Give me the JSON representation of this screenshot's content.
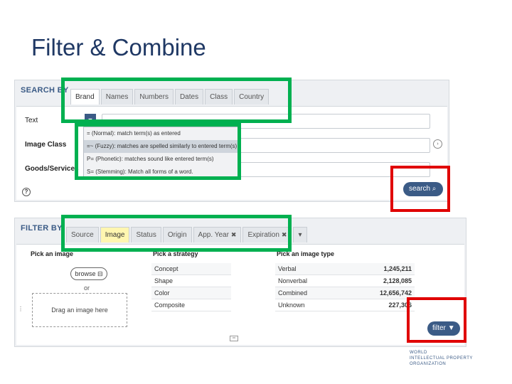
{
  "slide": {
    "title": "Filter & Combine"
  },
  "search": {
    "heading": "SEARCH BY",
    "tabs": [
      "Brand",
      "Names",
      "Numbers",
      "Dates",
      "Class",
      "Country"
    ],
    "active_tab": "Brand",
    "rows": {
      "text": "Text",
      "image_class": "Image Class",
      "goods_services": "Goods/Services"
    },
    "mode_menu": [
      "=  (Normal): match term(s) as entered",
      "=~ (Fuzzy): matches are spelled similarly to entered term(s)",
      "P= (Phonetic): matches sound like entered term(s)",
      "S= (Stemming): Match all forms of a word."
    ],
    "selected_mode_index": 1,
    "search_button": "search",
    "help_icon": "?"
  },
  "filter": {
    "heading": "FILTER BY",
    "tabs": [
      {
        "label": "Source",
        "closable": false
      },
      {
        "label": "Image",
        "closable": false
      },
      {
        "label": "Status",
        "closable": false
      },
      {
        "label": "Origin",
        "closable": false
      },
      {
        "label": "App. Year",
        "closable": true
      },
      {
        "label": "Expiration",
        "closable": true
      }
    ],
    "active_tab": "Image",
    "pick_image": "Pick an image",
    "browse_button": "browse",
    "or_text": "or",
    "drag_text": "Drag an image here",
    "pick_strategy": "Pick a strategy",
    "strategies": [
      "Concept",
      "Shape",
      "Color",
      "Composite"
    ],
    "pick_type": "Pick an image type",
    "image_types": [
      {
        "label": "Verbal",
        "count": "1,245,211"
      },
      {
        "label": "Nonverbal",
        "count": "2,128,085"
      },
      {
        "label": "Combined",
        "count": "12,656,742"
      },
      {
        "label": "Unknown",
        "count": "227,306"
      }
    ],
    "filter_button": "filter"
  },
  "logo": {
    "line1": "WORLD",
    "line2": "INTELLECTUAL PROPERTY",
    "line3": "ORGANIZATION"
  },
  "colors": {
    "brand": "#3b5b86",
    "highlight_green": "#00b050",
    "highlight_red": "#e00000"
  }
}
